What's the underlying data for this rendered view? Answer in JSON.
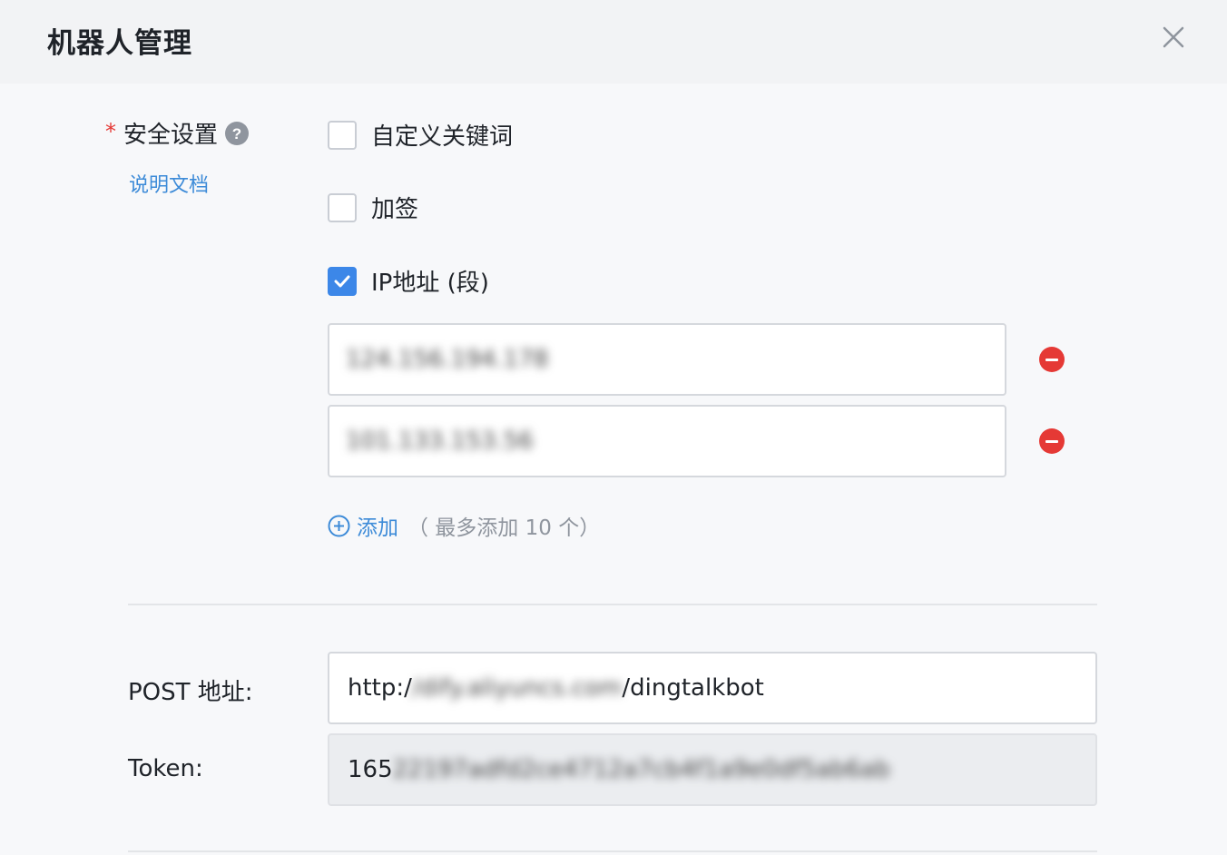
{
  "header": {
    "title": "机器人管理",
    "close_icon": "close-icon"
  },
  "security": {
    "required_mark": "*",
    "label": "安全设置",
    "help_icon": "question-circle-icon",
    "doc_link": "说明文档",
    "options": [
      {
        "label": "自定义关键词",
        "checked": false
      },
      {
        "label": "加签",
        "checked": false
      },
      {
        "label": "IP地址 (段)",
        "checked": true
      }
    ],
    "ip_values": [
      "124.156.194.178",
      "101.133.153.56"
    ],
    "add_label": "添加",
    "add_hint": "（ 最多添加 10 个）"
  },
  "post": {
    "label": "POST 地址:",
    "value_prefix": "http:/",
    "value_masked": "/dify.aliyuncs.com",
    "value_suffix": "/dingtalkbot"
  },
  "token": {
    "label": "Token:",
    "value_prefix": "165",
    "value_masked": "22197adfd2ce4712a7cb4f1a9e0df5ab6ab"
  },
  "colors": {
    "accent": "#3c87e8",
    "link": "#3d8bd8",
    "danger": "#e53935"
  }
}
